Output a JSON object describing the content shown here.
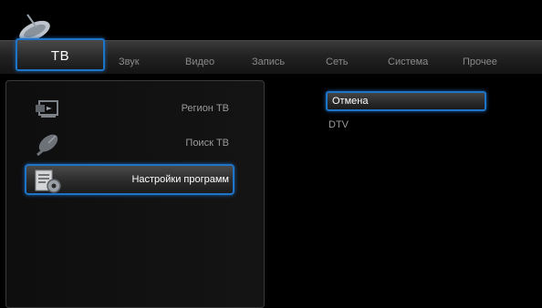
{
  "topmenu": {
    "tabs": [
      {
        "label": "ТВ"
      },
      {
        "label": "Звук"
      },
      {
        "label": "Видео"
      },
      {
        "label": "Запись"
      },
      {
        "label": "Сеть"
      },
      {
        "label": "Система"
      },
      {
        "label": "Прочее"
      }
    ]
  },
  "leftmenu": {
    "items": [
      {
        "label": "Регион ТВ",
        "icon": "tv-region-icon"
      },
      {
        "label": "Поиск ТВ",
        "icon": "satellite-dish-icon"
      },
      {
        "label": "Настройки программ",
        "icon": "settings-document-icon"
      }
    ]
  },
  "options": {
    "items": [
      {
        "label": "Отмена"
      },
      {
        "label": "DTV"
      }
    ]
  },
  "colors": {
    "accent": "#1e74c8",
    "background": "#000000",
    "text": "#9a9a9a"
  }
}
